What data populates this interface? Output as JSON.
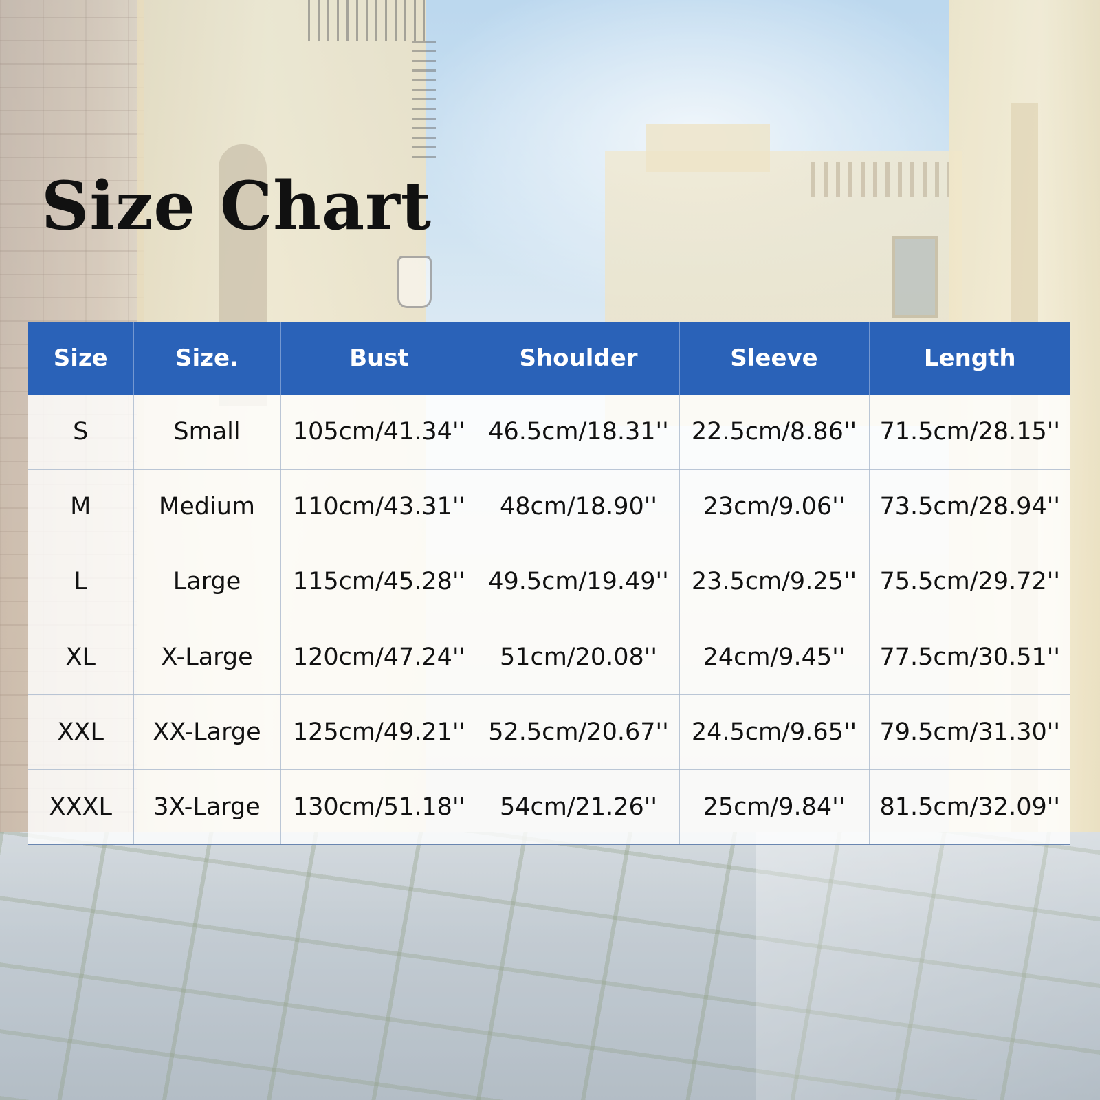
{
  "title": "Size Chart",
  "chart_data": {
    "type": "table",
    "title": "Size Chart",
    "columns": [
      "Size",
      "Size.",
      "Bust",
      "Shoulder",
      "Sleeve",
      "Length"
    ],
    "rows": [
      [
        "S",
        "Small",
        "105cm/41.34''",
        "46.5cm/18.31''",
        "22.5cm/8.86''",
        "71.5cm/28.15''"
      ],
      [
        "M",
        "Medium",
        "110cm/43.31''",
        "48cm/18.90''",
        "23cm/9.06''",
        "73.5cm/28.94''"
      ],
      [
        "L",
        "Large",
        "115cm/45.28''",
        "49.5cm/19.49''",
        "23.5cm/9.25''",
        "75.5cm/29.72''"
      ],
      [
        "XL",
        "X-Large",
        "120cm/47.24''",
        "51cm/20.08''",
        "24cm/9.45''",
        "77.5cm/30.51''"
      ],
      [
        "XXL",
        "XX-Large",
        "125cm/49.21''",
        "52.5cm/20.67''",
        "24.5cm/9.65''",
        "79.5cm/31.30''"
      ],
      [
        "XXXL",
        "3X-Large",
        "130cm/51.18''",
        "54cm/21.26''",
        "25cm/9.84''",
        "81.5cm/32.09''"
      ]
    ],
    "header_color": "#2a62b8"
  }
}
